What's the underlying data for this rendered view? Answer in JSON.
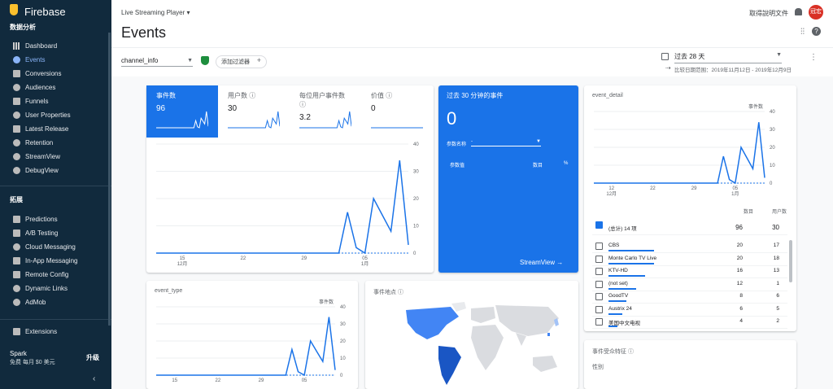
{
  "sidebar": {
    "brand": "Firebase",
    "section_analytics": "数据分析",
    "items": [
      {
        "label": "Dashboard"
      },
      {
        "label": "Events"
      },
      {
        "label": "Conversions"
      },
      {
        "label": "Audiences"
      },
      {
        "label": "Funnels"
      },
      {
        "label": "User Properties"
      },
      {
        "label": "Latest Release"
      },
      {
        "label": "Retention"
      },
      {
        "label": "StreamView"
      },
      {
        "label": "DebugView"
      }
    ],
    "section_extend": "拓展",
    "extend_items": [
      {
        "label": "Predictions"
      },
      {
        "label": "A/B Testing"
      },
      {
        "label": "Cloud Messaging"
      },
      {
        "label": "In-App Messaging"
      },
      {
        "label": "Remote Config"
      },
      {
        "label": "Dynamic Links"
      },
      {
        "label": "AdMob"
      }
    ],
    "extensions": "Extensions",
    "plan_name": "Spark",
    "plan_desc": "免费 每月 $0 美元",
    "upgrade": "升级",
    "collapse": "‹"
  },
  "header": {
    "project": "Live Streaming Player",
    "title": "Events",
    "docs": "取得說明文件",
    "avatar": "冠宏"
  },
  "filters": {
    "event_select": "channel_info",
    "add_filter": "添加过滤器",
    "date_range": "过去 28 天",
    "compare": "比较日期范围：2019年11月12日 - 2019年12月9日"
  },
  "main_card": {
    "tabs": [
      {
        "label": "事件数",
        "value": "96"
      },
      {
        "label": "用户数",
        "value": "30"
      },
      {
        "label": "每位用户事件数",
        "value": "3.2"
      },
      {
        "label": "价值",
        "value": "0"
      }
    ]
  },
  "realtime": {
    "title": "过去 30 分钟的事件",
    "count": "0",
    "param_label": "参数名称",
    "param_value": "-",
    "col1": "参数值",
    "col2": "数目",
    "col3": "%",
    "streamview": "StreamView"
  },
  "detail_card": {
    "title": "event_detail",
    "legend": "事件数",
    "col_count": "数目",
    "col_users": "用户数",
    "total_label": "(总计) 14 项",
    "total_count": "96",
    "total_users": "30",
    "rows": [
      {
        "name": "CBS",
        "count": "20",
        "users": "17"
      },
      {
        "name": "Monte Carlo TV Live",
        "count": "20",
        "users": "18"
      },
      {
        "name": "KTV-HD",
        "count": "16",
        "users": "13"
      },
      {
        "name": "(not set)",
        "count": "12",
        "users": "1"
      },
      {
        "name": "GoodTV",
        "count": "8",
        "users": "6"
      },
      {
        "name": "Austrix 24",
        "count": "6",
        "users": "5"
      },
      {
        "name": "美国中文电视",
        "count": "4",
        "users": "2"
      }
    ]
  },
  "event_type_card": {
    "title": "event_type",
    "legend": "事件数"
  },
  "map_card": {
    "title": "事件地点"
  },
  "audience_card": {
    "title": "事件受众特征",
    "subtitle": "性别"
  },
  "chart_data": [
    {
      "type": "line",
      "title": "",
      "x_ticks": [
        "15\n12月",
        "22",
        "29",
        "05\n1月"
      ],
      "y_ticks": [
        0,
        10,
        20,
        30,
        40
      ],
      "ylim": [
        0,
        40
      ],
      "series": [
        {
          "values": [
            0,
            0,
            0,
            0,
            0,
            0,
            0,
            0,
            0,
            0,
            0,
            0,
            0,
            0,
            0,
            0,
            0,
            0,
            0,
            0,
            0,
            0,
            15,
            2,
            0,
            20,
            14,
            8,
            34,
            3
          ]
        }
      ]
    },
    {
      "type": "line",
      "title": "",
      "x_ticks": [
        "12\n12月",
        "22",
        "29",
        "05\n1月"
      ],
      "y_ticks": [
        0,
        10,
        20,
        30,
        40
      ],
      "ylim": [
        0,
        40
      ],
      "series": [
        {
          "name": "事件数",
          "values": [
            0,
            0,
            0,
            0,
            0,
            0,
            0,
            0,
            0,
            0,
            0,
            0,
            0,
            0,
            0,
            0,
            0,
            0,
            0,
            0,
            0,
            0,
            15,
            2,
            0,
            20,
            14,
            8,
            34,
            3
          ]
        }
      ]
    },
    {
      "type": "line",
      "title": "",
      "x_ticks": [
        "15",
        "22",
        "29",
        "05"
      ],
      "y_ticks": [
        0,
        10,
        20,
        30,
        40
      ],
      "ylim": [
        0,
        40
      ],
      "series": [
        {
          "name": "事件数",
          "values": [
            0,
            0,
            0,
            0,
            0,
            0,
            0,
            0,
            0,
            0,
            0,
            0,
            0,
            0,
            0,
            0,
            0,
            0,
            0,
            0,
            0,
            0,
            15,
            2,
            0,
            20,
            14,
            8,
            34,
            3
          ]
        }
      ]
    }
  ],
  "colors": {
    "accent": "#1a73e8",
    "sidebar": "#112a3d"
  }
}
